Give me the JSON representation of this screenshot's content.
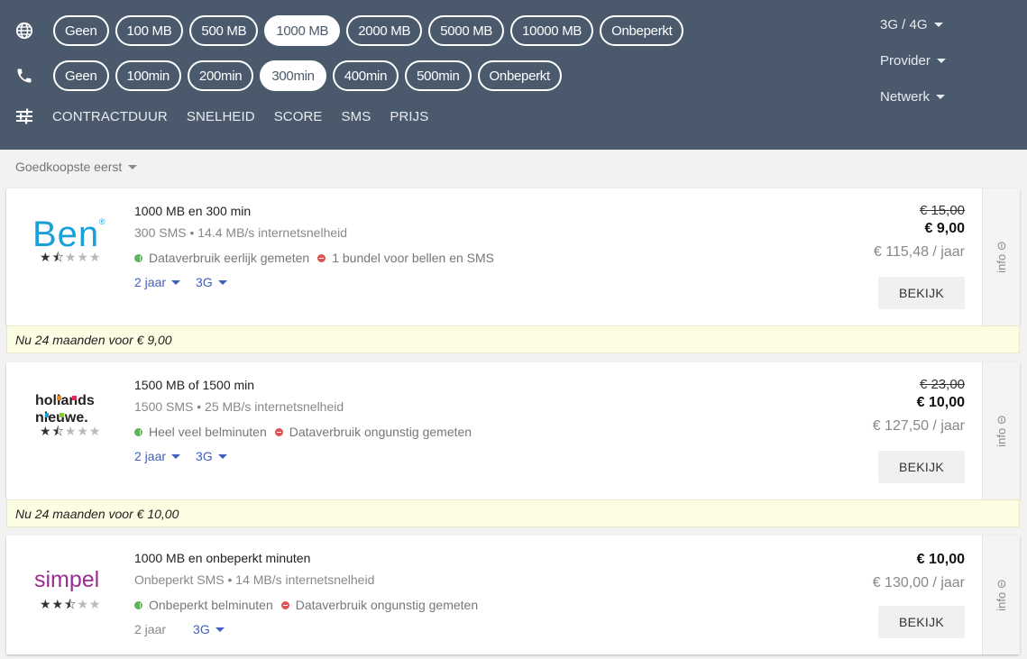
{
  "filters": {
    "data": {
      "icon": "globe-icon",
      "options": [
        "Geen",
        "100 MB",
        "500 MB",
        "1000 MB",
        "2000 MB",
        "5000 MB",
        "10000 MB",
        "Onbeperkt"
      ],
      "selected": "1000 MB"
    },
    "minutes": {
      "icon": "phone-icon",
      "options": [
        "Geen",
        "100min",
        "200min",
        "300min",
        "400min",
        "500min",
        "Onbeperkt"
      ],
      "selected": "300min"
    },
    "extra": {
      "icon": "sliders-icon",
      "links": [
        "CONTRACTDUUR",
        "SNELHEID",
        "SCORE",
        "SMS",
        "PRIJS"
      ]
    },
    "dropdowns": [
      "3G / 4G",
      "Provider",
      "Netwerk"
    ],
    "background": "#4a5a6c"
  },
  "sort": {
    "label": "Goedkoopste eerst"
  },
  "offers": [
    {
      "provider": "Ben",
      "rating": 1.5,
      "title": "1000 MB en 300 min",
      "subtitle": "300 SMS • 14.4 MB/s internetsnelheid",
      "features": [
        {
          "type": "plus",
          "text": "Dataverbruik eerlijk gemeten"
        },
        {
          "type": "minus",
          "text": "1 bundel voor bellen en SMS"
        }
      ],
      "duration": "2 jaar",
      "network": "3G",
      "old_price": "€ 15,00",
      "price": "€ 9,00",
      "yearly": "€ 115,48 / jaar",
      "button": "BEKIJK",
      "info": "info ⊝",
      "promo": "Nu 24 maanden voor € 9,00"
    },
    {
      "provider": "hollandsnieuwe",
      "rating": 1.5,
      "title": "1500 MB of 1500 min",
      "subtitle": "1500 SMS • 25 MB/s internetsnelheid",
      "features": [
        {
          "type": "plus",
          "text": "Heel veel belminuten"
        },
        {
          "type": "minus",
          "text": "Dataverbruik ongunstig gemeten"
        }
      ],
      "duration": "2 jaar",
      "network": "3G",
      "old_price": "€ 23,00",
      "price": "€ 10,00",
      "yearly": "€ 127,50 / jaar",
      "button": "BEKIJK",
      "info": "info ⊝",
      "promo": "Nu 24 maanden voor € 10,00"
    },
    {
      "provider": "simpel",
      "rating": 2.5,
      "title": "1000 MB en onbeperkt minuten",
      "subtitle": "Onbeperkt SMS • 14 MB/s internetsnelheid",
      "features": [
        {
          "type": "plus",
          "text": "Onbeperkt belminuten"
        },
        {
          "type": "minus",
          "text": "Dataverbruik ongunstig gemeten"
        }
      ],
      "duration": "2 jaar",
      "network": "3G",
      "price": "€ 10,00",
      "yearly": "€ 130,00 / jaar",
      "button": "BEKIJK",
      "info": "info ⊝"
    }
  ],
  "colors": {
    "accent_link": "#3f5fbf",
    "plus": "#5fb35f",
    "minus": "#e05252",
    "ben_logo": "#1aa0d9",
    "simpel_logo": "#9b2d8f",
    "promo_bg": "#fdfde4"
  }
}
